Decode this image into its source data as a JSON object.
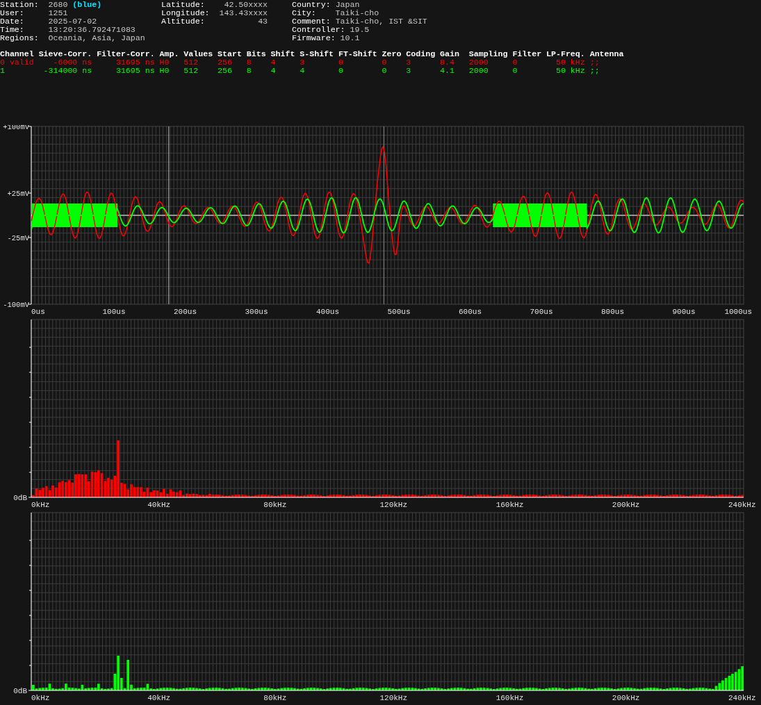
{
  "station": {
    "label": "Station:",
    "value": "2680",
    "tag": "(blue)"
  },
  "info_columns": [
    [
      {
        "label": "User:",
        "value": "1251"
      },
      {
        "label": "Date:",
        "value": "2025-07-02"
      },
      {
        "label": "Time:",
        "value": "13:20:36.792471083"
      },
      {
        "label": "Regions:",
        "value": "Oceania, Asia, Japan"
      }
    ],
    [
      {
        "label": "Latitude:",
        "value": "42.50xxxx"
      },
      {
        "label": "Longitude:",
        "value": "143.43xxxx"
      },
      {
        "label": "Altitude:",
        "value": "43"
      }
    ],
    [
      {
        "label": "Country:",
        "value": "Japan"
      },
      {
        "label": "City:",
        "value": "Taiki-cho"
      },
      {
        "label": "Comment:",
        "value": "Taiki-cho, IST &SIT"
      },
      {
        "label": "Controller:",
        "value": "19.5"
      },
      {
        "label": "Firmware:",
        "value": "10.1"
      }
    ]
  ],
  "table": {
    "columns": [
      "Channel",
      "Sieve-Corr.",
      "Filter-Corr.",
      "Amp.",
      "Values",
      "Start",
      "Bits",
      "Shift",
      "S-Shift",
      "FT-Shift",
      "Zero",
      "Coding",
      "Gain",
      "Sampling",
      "Filter",
      "LP-Freq.",
      "Antenna"
    ],
    "rows": [
      {
        "color": "#ff0000",
        "cells": [
          "0 valid",
          "-6000 ns",
          "31695 ns",
          "H0",
          "512",
          "256",
          "8",
          "4",
          "3",
          "0",
          "0",
          "3",
          "8.4",
          "2000",
          "0",
          "50 kHz",
          ";;"
        ]
      },
      {
        "color": "#00ff00",
        "cells": [
          "1",
          "-314000 ns",
          "31695 ns",
          "H0",
          "512",
          "256",
          "8",
          "4",
          "4",
          "0",
          "0",
          "3",
          "4.1",
          "2000",
          "0",
          "50 kHz",
          ";;"
        ]
      }
    ]
  },
  "charts": [
    {
      "kind": "waveform",
      "y_labels": [
        "+100mV",
        "+25mV",
        "-25mV",
        "-100mV"
      ],
      "x_labels": [
        "0us",
        "100us",
        "200us",
        "300us",
        "400us",
        "500us",
        "600us",
        "700us",
        "800us",
        "900us",
        "1000us"
      ]
    },
    {
      "kind": "spectrum",
      "color": "#ff0000",
      "y_labels": [
        "0dB"
      ],
      "x_labels": [
        "0kHz",
        "40kHz",
        "80kHz",
        "120kHz",
        "160kHz",
        "200kHz",
        "240kHz"
      ]
    },
    {
      "kind": "spectrum",
      "color": "#00ff00",
      "y_labels": [
        "0dB"
      ],
      "x_labels": [
        "0kHz",
        "40kHz",
        "80kHz",
        "120kHz",
        "160kHz",
        "200kHz",
        "240kHz"
      ]
    }
  ]
}
